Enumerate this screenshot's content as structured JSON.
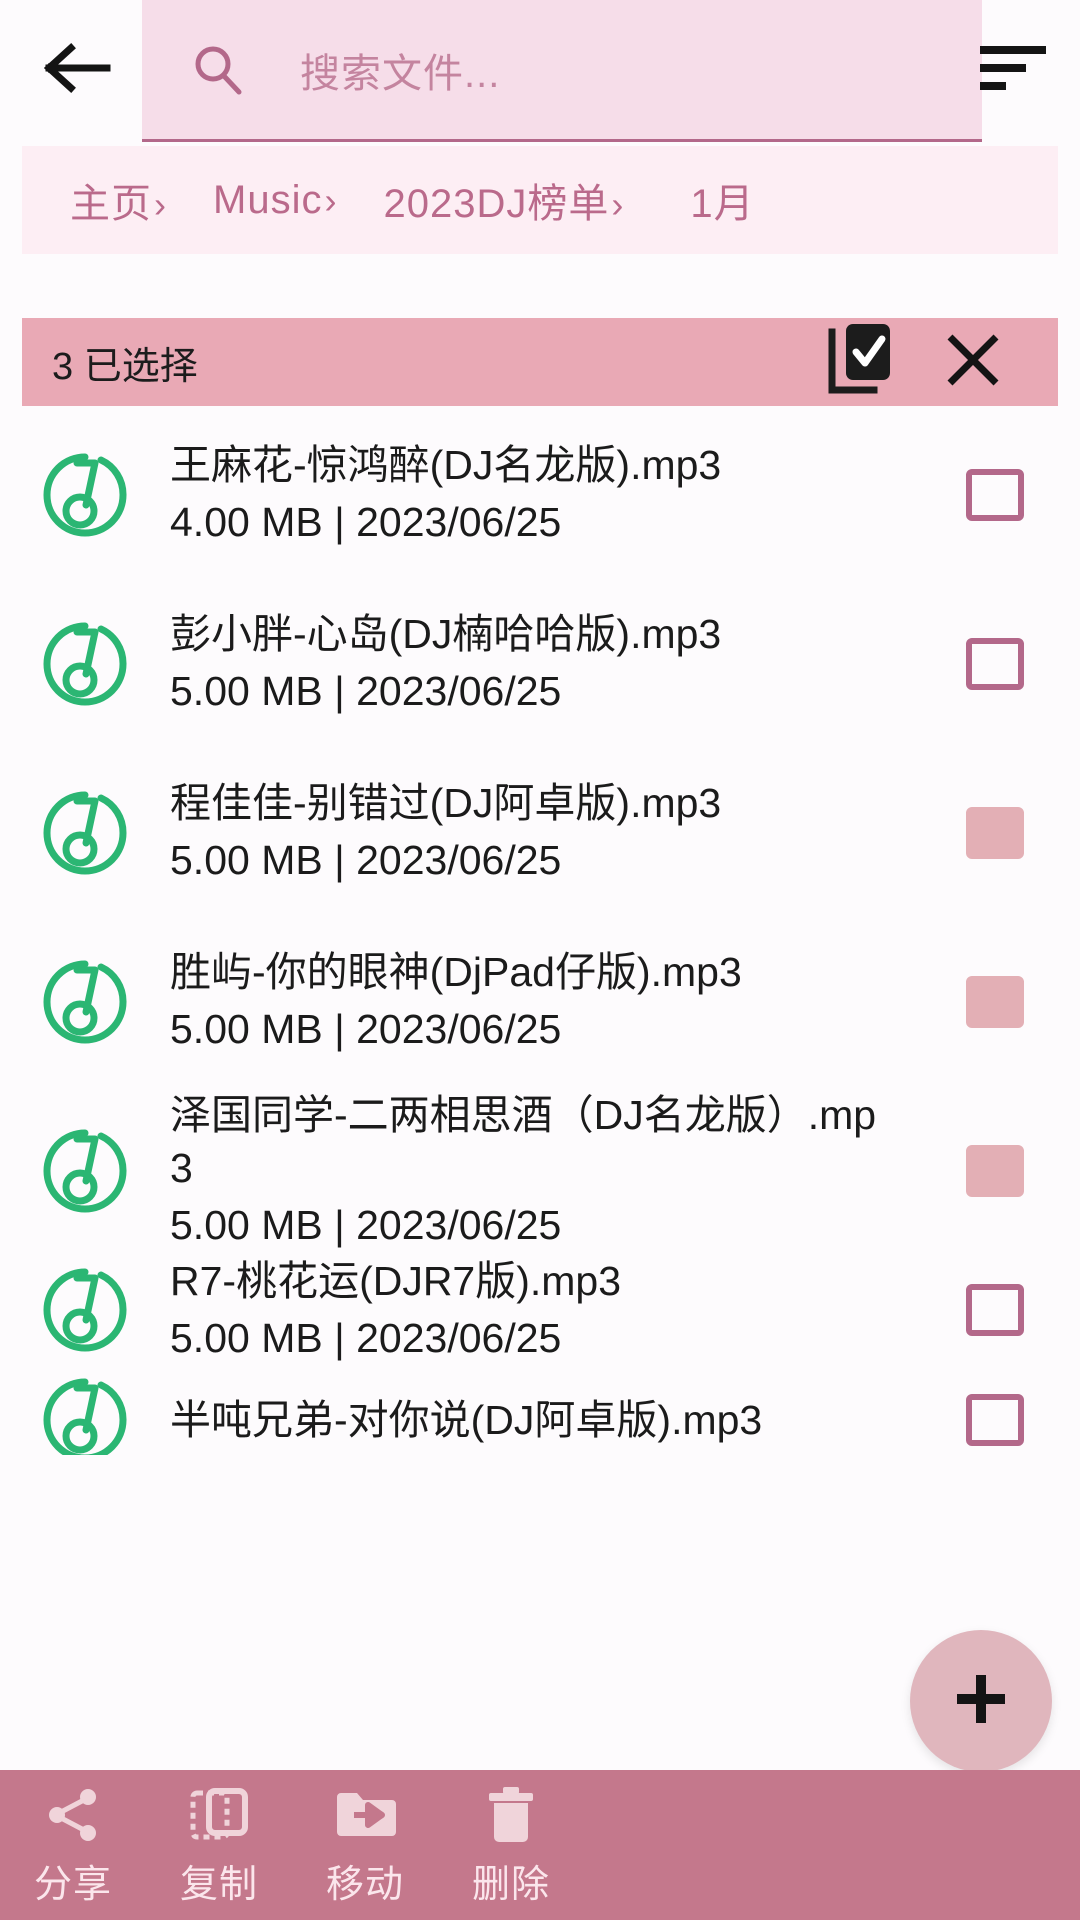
{
  "topbar": {
    "back_icon": "arrow-left-icon",
    "search_placeholder": "搜索文件...",
    "search_value": "",
    "search_icon": "search-icon",
    "sort_icon": "sort-icon"
  },
  "breadcrumb": {
    "separator": "›",
    "items": [
      {
        "label": "主页",
        "has_sep": true
      },
      {
        "label": "Music",
        "has_sep": true
      },
      {
        "label": "2023DJ榜单",
        "has_sep": true
      },
      {
        "label": "1月",
        "has_sep": false
      }
    ]
  },
  "selection_bar": {
    "count_text": "3 已选择",
    "select_all_icon": "library-add-check-icon",
    "close_icon": "close-icon",
    "background": "#e9a9b5"
  },
  "files": [
    {
      "name": "王麻花-惊鸿醉(DJ名龙版).mp3",
      "meta": "4.00 MB | 2023/06/25",
      "checked": false,
      "icon": "music-note-icon"
    },
    {
      "name": "彭小胖-心岛(DJ楠哈哈版).mp3",
      "meta": "5.00 MB | 2023/06/25",
      "checked": false,
      "icon": "music-note-icon"
    },
    {
      "name": "程佳佳-别错过(DJ阿卓版).mp3",
      "meta": "5.00 MB | 2023/06/25",
      "checked": true,
      "icon": "music-note-icon"
    },
    {
      "name": "胜屿-你的眼神(DjPad仔版).mp3",
      "meta": "5.00 MB | 2023/06/25",
      "checked": true,
      "icon": "music-note-icon"
    },
    {
      "name": "泽国同学-二两相思酒（DJ名龙版）.mp3",
      "meta": "5.00 MB | 2023/06/25",
      "checked": true,
      "icon": "music-note-icon"
    },
    {
      "name": "R7-桃花运(DJR7版).mp3",
      "meta": "5.00 MB | 2023/06/25",
      "checked": false,
      "icon": "music-note-icon"
    },
    {
      "name": "半吨兄弟-对你说(DJ阿卓版).mp3",
      "meta": "",
      "checked": false,
      "icon": "music-note-icon"
    }
  ],
  "fab": {
    "icon": "plus-icon",
    "color": "#e0b6bd"
  },
  "bottom_toolbar": {
    "background": "#c4788c",
    "items": [
      {
        "label": "分享",
        "icon": "share-icon"
      },
      {
        "label": "复制",
        "icon": "copy-icon"
      },
      {
        "label": "移动",
        "icon": "move-folder-icon"
      },
      {
        "label": "删除",
        "icon": "trash-icon"
      }
    ]
  },
  "theme": {
    "accent": "#b3688a",
    "search_bg": "#f6dde9",
    "crumb_bg": "#fdeef4",
    "music_icon_color": "#2bb673",
    "page_bg": "#fdfbfd"
  }
}
